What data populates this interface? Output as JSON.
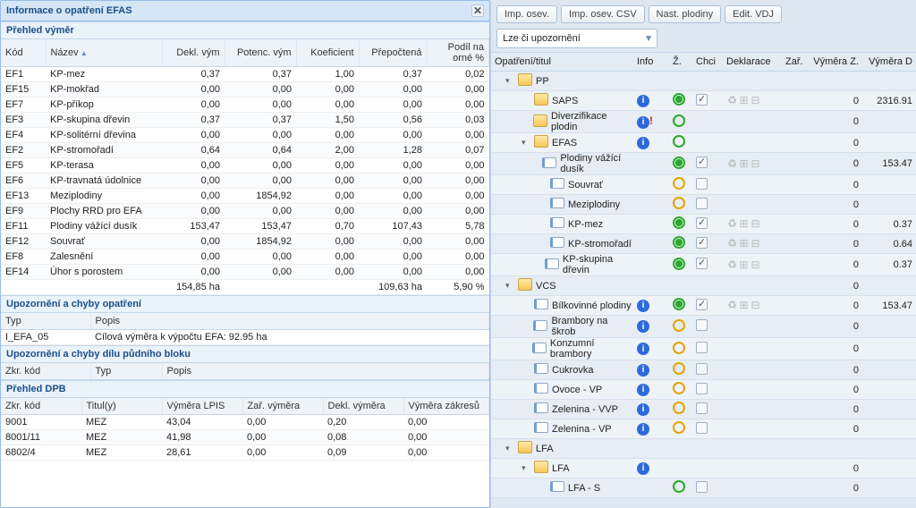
{
  "panel": {
    "title": "Informace o opatření EFAS",
    "sections": {
      "vymery": "Přehled výměr",
      "upoz": "Upozornění a chyby opatření",
      "dpbu": "Upozornění a chyby dílu půdního bloku",
      "dpb": "Přehled DPB"
    }
  },
  "vymery": {
    "cols": [
      "Kód",
      "Název",
      "Dekl. vým",
      "Potenc. vým",
      "Koeficient",
      "Přepočtená",
      "Podíl na orné %"
    ],
    "sort_arrow": "▲",
    "rows": [
      [
        "EF1",
        "KP-mez",
        "0,37",
        "0,37",
        "1,00",
        "0,37",
        "0,02"
      ],
      [
        "EF15",
        "KP-mokřad",
        "0,00",
        "0,00",
        "0,00",
        "0,00",
        "0,00"
      ],
      [
        "EF7",
        "KP-příkop",
        "0,00",
        "0,00",
        "0,00",
        "0,00",
        "0,00"
      ],
      [
        "EF3",
        "KP-skupina dřevin",
        "0,37",
        "0,37",
        "1,50",
        "0,56",
        "0,03"
      ],
      [
        "EF4",
        "KP-solitérní dřevina",
        "0,00",
        "0,00",
        "0,00",
        "0,00",
        "0,00"
      ],
      [
        "EF2",
        "KP-stromořadí",
        "0,64",
        "0,64",
        "2,00",
        "1,28",
        "0,07"
      ],
      [
        "EF5",
        "KP-terasa",
        "0,00",
        "0,00",
        "0,00",
        "0,00",
        "0,00"
      ],
      [
        "EF6",
        "KP-travnatá údolnice",
        "0,00",
        "0,00",
        "0,00",
        "0,00",
        "0,00"
      ],
      [
        "EF13",
        "Meziplodiny",
        "0,00",
        "1854,92",
        "0,00",
        "0,00",
        "0,00"
      ],
      [
        "EF9",
        "Plochy RRD pro EFA",
        "0,00",
        "0,00",
        "0,00",
        "0,00",
        "0,00"
      ],
      [
        "EF11",
        "Plodiny vážící dusík",
        "153,47",
        "153,47",
        "0,70",
        "107,43",
        "5,78"
      ],
      [
        "EF12",
        "Souvrať",
        "0,00",
        "1854,92",
        "0,00",
        "0,00",
        "0,00"
      ],
      [
        "EF8",
        "Zalesnění",
        "0,00",
        "0,00",
        "0,00",
        "0,00",
        "0,00"
      ],
      [
        "EF14",
        "Úhor s porostem",
        "0,00",
        "0,00",
        "0,00",
        "0,00",
        "0,00"
      ]
    ],
    "footer": [
      "",
      "",
      "154,85 ha",
      "",
      "",
      "109,63 ha",
      "5,90 %"
    ]
  },
  "upoz": {
    "cols": [
      "Typ",
      "Popis"
    ],
    "rows": [
      [
        "I_EFA_05",
        "Cílová výměra k výpočtu EFA: 92.95 ha"
      ]
    ]
  },
  "dpbu": {
    "cols": [
      "Zkr. kód",
      "Typ",
      "Popis"
    ]
  },
  "dpb": {
    "cols": [
      "Zkr. kód",
      "Titul(y)",
      "Výměra LPIS",
      "Zař. výměra",
      "Dekl. výměra",
      "Výměra zákresů"
    ],
    "rows": [
      [
        "9001",
        "MEZ",
        "43,04",
        "0,00",
        "0,20",
        "0,00"
      ],
      [
        "8001/11",
        "MEZ",
        "41,98",
        "0,00",
        "0,08",
        "0,00"
      ],
      [
        "6802/4",
        "MEZ",
        "28,61",
        "0,00",
        "0,09",
        "0,00"
      ]
    ]
  },
  "toolbar": {
    "b1": "Imp. osev.",
    "b2": "Imp. osev. CSV",
    "b3": "Nast. plodiny",
    "b4": "Edit. VDJ",
    "combo": "Lze či upozornění"
  },
  "tree": {
    "headers": [
      "Opatření/titul",
      "Info",
      "Ž.",
      "Chci",
      "Deklarace",
      "Zař.",
      "Výměra Z.",
      "Výměra D"
    ],
    "nodes": [
      {
        "d": 0,
        "t": "folder",
        "exp": "▾",
        "label": "PP"
      },
      {
        "d": 1,
        "t": "folder",
        "label": "SAPS",
        "info": true,
        "ring": "green-dot",
        "chk": true,
        "grey": true,
        "vz": "0",
        "vd": "2316.91"
      },
      {
        "d": 1,
        "t": "folder",
        "label": "Diverzifikace plodin",
        "info": true,
        "warn": true,
        "ring": "green",
        "vz": "0"
      },
      {
        "d": 1,
        "t": "folder",
        "exp": "▾",
        "label": "EFAS",
        "info": true,
        "ring": "green",
        "vz": "0"
      },
      {
        "d": 2,
        "t": "leaf",
        "label": "Plodiny vážící dusík",
        "ring": "green-dot",
        "chk": true,
        "grey": true,
        "vz": "0",
        "vd": "153.47"
      },
      {
        "d": 2,
        "t": "leaf",
        "label": "Souvrať",
        "ring": "orange",
        "chk": false,
        "vz": "0"
      },
      {
        "d": 2,
        "t": "leaf",
        "label": "Meziplodiny",
        "ring": "orange",
        "chk": false,
        "vz": "0"
      },
      {
        "d": 2,
        "t": "leaf",
        "label": "KP-mez",
        "ring": "green-dot",
        "chk": true,
        "grey": true,
        "vz": "0",
        "vd": "0.37"
      },
      {
        "d": 2,
        "t": "leaf",
        "label": "KP-stromořadí",
        "ring": "green-dot",
        "chk": true,
        "grey": true,
        "vz": "0",
        "vd": "0.64"
      },
      {
        "d": 2,
        "t": "leaf",
        "label": "KP-skupina dřevin",
        "ring": "green-dot",
        "chk": true,
        "grey": true,
        "vz": "0",
        "vd": "0.37"
      },
      {
        "d": 0,
        "t": "folder",
        "exp": "▾",
        "label": "VCS",
        "vz": "0"
      },
      {
        "d": 1,
        "t": "leaf",
        "label": "Bílkovinné plodiny",
        "info": true,
        "ring": "green-dot",
        "chk": true,
        "grey": true,
        "vz": "0",
        "vd": "153.47"
      },
      {
        "d": 1,
        "t": "leaf",
        "label": "Brambory na škrob",
        "info": true,
        "ring": "orange",
        "chk": false,
        "vz": "0"
      },
      {
        "d": 1,
        "t": "leaf",
        "label": "Konzumní brambory",
        "info": true,
        "ring": "orange",
        "chk": false,
        "vz": "0"
      },
      {
        "d": 1,
        "t": "leaf",
        "label": "Cukrovka",
        "info": true,
        "ring": "orange",
        "chk": false,
        "vz": "0"
      },
      {
        "d": 1,
        "t": "leaf",
        "label": "Ovoce - VP",
        "info": true,
        "ring": "orange",
        "chk": false,
        "vz": "0"
      },
      {
        "d": 1,
        "t": "leaf",
        "label": "Zelenina - VVP",
        "info": true,
        "ring": "orange",
        "chk": false,
        "vz": "0"
      },
      {
        "d": 1,
        "t": "leaf",
        "label": "Zelenina - VP",
        "info": true,
        "ring": "orange",
        "chk": false,
        "vz": "0"
      },
      {
        "d": 0,
        "t": "folder",
        "exp": "▾",
        "label": "LFA"
      },
      {
        "d": 1,
        "t": "folder",
        "exp": "▾",
        "label": "LFA",
        "info": true,
        "vz": "0"
      },
      {
        "d": 2,
        "t": "leaf",
        "label": "LFA - S",
        "ring": "green",
        "chk": false,
        "vz": "0"
      }
    ]
  }
}
